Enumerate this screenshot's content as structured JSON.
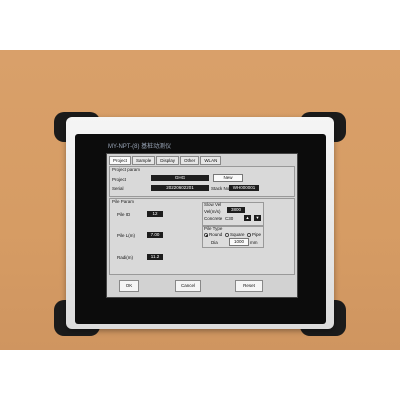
{
  "device": {
    "title": "MY-NPT-(8)  基桩动测仪"
  },
  "tabs": [
    {
      "label": "Project"
    },
    {
      "label": "Sample"
    },
    {
      "label": "Display"
    },
    {
      "label": "Other"
    },
    {
      "label": "WLAN"
    }
  ],
  "project_param": {
    "group_title": "Project param",
    "project_label": "Project",
    "project_value": "GHG",
    "new_button": "New",
    "serial_label": "Serial",
    "serial_value": "20220602201",
    "stack_no_label": "Stack No",
    "stack_no_value": "WH000001"
  },
  "pile_param": {
    "group_title": "Pile Param",
    "pile_id_label": "Pile ID",
    "pile_id_value": "12",
    "pile_length_label": "Pile L(m)",
    "pile_length_value": "7.00",
    "radius_label": "Radi(m)",
    "radius_value": "11.2"
  },
  "wave": {
    "group_title": "Slow Vel",
    "vel_label": "Vel(m/s)",
    "vel_value": "3800",
    "concrete_label": "Concrete",
    "concrete_value": "C30",
    "up_button": "▲",
    "down_button": "▼"
  },
  "pile_type": {
    "group_title": "Pile Type",
    "options": [
      {
        "label": "Round",
        "selected": true
      },
      {
        "label": "Square",
        "selected": false
      },
      {
        "label": "Pipe",
        "selected": false
      }
    ],
    "dia_label": "Dia",
    "dia_value": "1000",
    "dia_unit": "mm"
  },
  "footer": {
    "ok_button": "OK",
    "cancel_button": "Cancel",
    "reset_button": "Reset"
  }
}
